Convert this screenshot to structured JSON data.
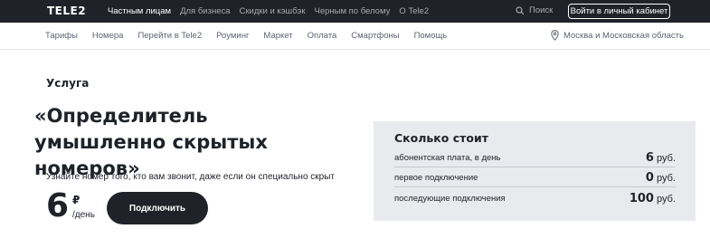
{
  "header": {
    "logo": "TELE2",
    "nav": [
      "Частным лицам",
      "Для бизнеса",
      "Скидки и кэшбэк",
      "Черным по белому",
      "О Tele2"
    ],
    "search_label": "Поиск",
    "login_label": "Войти в личный кабинет"
  },
  "subnav": {
    "items": [
      "Тарифы",
      "Номера",
      "Перейти в Tele2",
      "Роуминг",
      "Маркет",
      "Оплата",
      "Смартфоны",
      "Помощь"
    ],
    "region": "Москва и Московская область"
  },
  "main": {
    "kicker": "Услуга",
    "title": "«Определитель умышленно скрытых номеров»",
    "description": "Узнайте номер того, кто вам звонит, даже если он специально скрыт",
    "price": "6",
    "currency": "₽",
    "price_unit": "/день",
    "connect_label": "Подключить"
  },
  "cost": {
    "title": "Сколько стоит",
    "rows": [
      {
        "label": "абонентская плата, в день",
        "amount": "6",
        "unit": "руб."
      },
      {
        "label": "первое подключение",
        "amount": "0",
        "unit": "руб."
      },
      {
        "label": "последующие подключения",
        "amount": "100",
        "unit": "руб."
      }
    ]
  },
  "colors": {
    "dark": "#1f2229",
    "panel": "#e9eaed",
    "muted": "#5f6470"
  },
  "icons": [
    "search-icon",
    "location-pin-icon"
  ]
}
